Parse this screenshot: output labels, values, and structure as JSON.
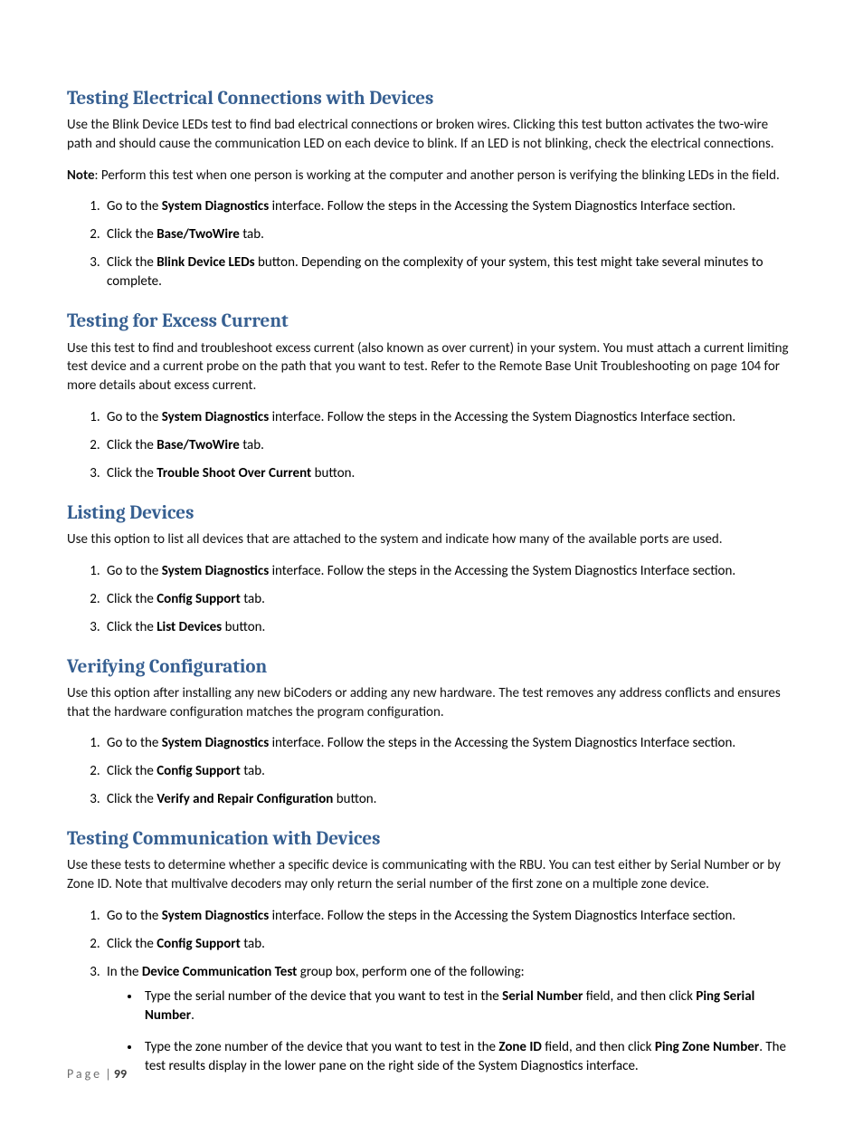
{
  "sections": [
    {
      "heading": "Testing Electrical Connections with Devices",
      "paragraphs": [
        [
          {
            "t": "Use the Blink Device LEDs test to find bad electrical connections or broken wires. Clicking this test button activates the two-wire path and should cause the communication LED on each device to blink. If an LED is not blinking, check the electrical connections."
          }
        ],
        [
          {
            "t": "Note",
            "b": true
          },
          {
            "t": ": Perform this test when one person is working at the computer and another person is verifying the blinking LEDs in the field."
          }
        ]
      ],
      "steps": [
        [
          {
            "t": "Go to the "
          },
          {
            "t": "System Diagnostics",
            "b": true
          },
          {
            "t": " interface. Follow the steps in the Accessing the System Diagnostics Interface section."
          }
        ],
        [
          {
            "t": "Click the "
          },
          {
            "t": "Base/TwoWire",
            "b": true
          },
          {
            "t": " tab."
          }
        ],
        [
          {
            "t": "Click the "
          },
          {
            "t": "Blink Device LEDs",
            "b": true
          },
          {
            "t": " button. Depending on the complexity of your system, this test might take several minutes to complete."
          }
        ]
      ]
    },
    {
      "heading": "Testing for Excess Current",
      "paragraphs": [
        [
          {
            "t": "Use this test to find and troubleshoot excess current (also known as over current) in your system. You must attach a current limiting test device and a current probe on the path that you want to test. Refer to the Remote Base Unit Troubleshooting on page 104 for more details about excess current."
          }
        ]
      ],
      "steps": [
        [
          {
            "t": "Go to the "
          },
          {
            "t": "System Diagnostics",
            "b": true
          },
          {
            "t": " interface. Follow the steps in the Accessing the System Diagnostics Interface section."
          }
        ],
        [
          {
            "t": "Click the "
          },
          {
            "t": "Base/TwoWire",
            "b": true
          },
          {
            "t": " tab."
          }
        ],
        [
          {
            "t": "Click the "
          },
          {
            "t": "Trouble Shoot Over Current",
            "b": true
          },
          {
            "t": " button."
          }
        ]
      ]
    },
    {
      "heading": "Listing Devices",
      "paragraphs": [
        [
          {
            "t": "Use this option to list all devices that are attached to the system and indicate how many of the available ports are used."
          }
        ]
      ],
      "steps": [
        [
          {
            "t": "Go to the "
          },
          {
            "t": "System Diagnostics",
            "b": true
          },
          {
            "t": " interface. Follow the steps in the Accessing the System Diagnostics Interface section."
          }
        ],
        [
          {
            "t": "Click the "
          },
          {
            "t": "Config Support",
            "b": true
          },
          {
            "t": " tab."
          }
        ],
        [
          {
            "t": "Click the "
          },
          {
            "t": "List Devices",
            "b": true
          },
          {
            "t": " button."
          }
        ]
      ]
    },
    {
      "heading": "Verifying Configuration",
      "paragraphs": [
        [
          {
            "t": "Use this option after installing any new biCoders or adding any new hardware. The test removes any address conflicts and ensures that the hardware configuration matches the program configuration."
          }
        ]
      ],
      "steps": [
        [
          {
            "t": "Go to the "
          },
          {
            "t": "System Diagnostics",
            "b": true
          },
          {
            "t": " interface. Follow the steps in the Accessing the System Diagnostics Interface section."
          }
        ],
        [
          {
            "t": "Click the "
          },
          {
            "t": "Config Support",
            "b": true
          },
          {
            "t": " tab."
          }
        ],
        [
          {
            "t": "Click the "
          },
          {
            "t": "Verify and Repair Configuration",
            "b": true
          },
          {
            "t": " button."
          }
        ]
      ]
    },
    {
      "heading": "Testing Communication with Devices",
      "paragraphs": [
        [
          {
            "t": "Use these tests to determine whether a specific device is communicating with the RBU. You can test either by Serial Number or by Zone ID. Note that multivalve decoders may only return the serial number of the first zone on a multiple zone device."
          }
        ]
      ],
      "steps": [
        [
          {
            "t": "Go to the "
          },
          {
            "t": "System Diagnostics",
            "b": true
          },
          {
            "t": " interface. Follow the steps in the Accessing the System Diagnostics Interface section."
          }
        ],
        [
          {
            "t": "Click the "
          },
          {
            "t": "Config Support",
            "b": true
          },
          {
            "t": " tab."
          }
        ],
        [
          {
            "t": "In the "
          },
          {
            "t": "Device Communication Test",
            "b": true
          },
          {
            "t": " group box, perform one of the following:"
          }
        ]
      ],
      "bullets": [
        [
          {
            "t": "Type the serial number of the device that you want to test in the "
          },
          {
            "t": "Serial Number",
            "b": true
          },
          {
            "t": " field, and then click "
          },
          {
            "t": "Ping Serial Number",
            "b": true
          },
          {
            "t": "."
          }
        ],
        [
          {
            "t": "Type the zone number of the device that you want to test in the "
          },
          {
            "t": "Zone ID",
            "b": true
          },
          {
            "t": " field, and then click "
          },
          {
            "t": "Ping Zone Number",
            "b": true
          },
          {
            "t": ". The test results display in the lower pane on the right side of the System Diagnostics interface."
          }
        ]
      ]
    }
  ],
  "footer": {
    "label": "Page",
    "sep": " | ",
    "number": "99"
  }
}
